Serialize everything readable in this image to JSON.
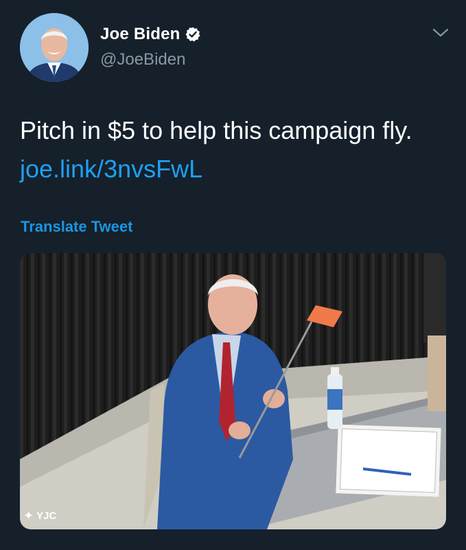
{
  "tweet": {
    "author": {
      "display_name": "Joe Biden",
      "handle": "@JoeBiden",
      "verified": true
    },
    "text": "Pitch in $5 to help this campaign fly.",
    "link": "joe.link/3nvsFwL",
    "translate_label": "Translate Tweet",
    "menu_icon": "chevron-down-icon",
    "media": {
      "watermark": "YJC"
    }
  },
  "colors": {
    "background": "#15202b",
    "text": "#ffffff",
    "secondary_text": "#8899a6",
    "link": "#1da1f2",
    "verified_badge": "#ffffff"
  }
}
